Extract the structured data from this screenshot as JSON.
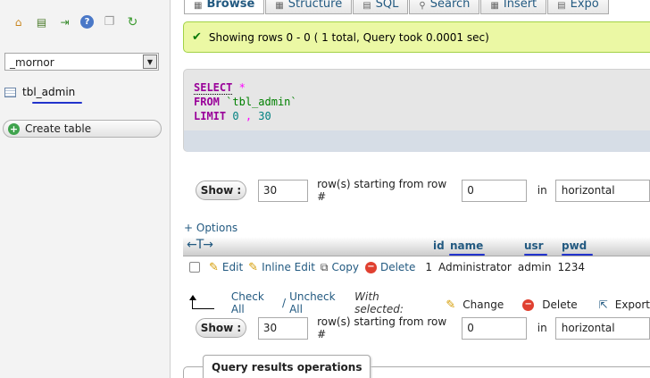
{
  "nav_panel": {
    "icons": [
      "home-icon",
      "database-icon",
      "logout-icon",
      "help-icon",
      "docs-icon",
      "reload-icon"
    ],
    "database_select": {
      "value": "_mornor"
    },
    "table_item": {
      "label": "tbl_admin"
    },
    "create_table_label": "Create table"
  },
  "tabs": [
    {
      "label": "Browse",
      "icon": "browse-icon"
    },
    {
      "label": "Structure",
      "icon": "structure-icon"
    },
    {
      "label": "SQL",
      "icon": "sql-icon"
    },
    {
      "label": "Search",
      "icon": "search-icon"
    },
    {
      "label": "Insert",
      "icon": "insert-icon"
    },
    {
      "label": "Expo",
      "icon": "export-icon"
    }
  ],
  "success_message": "Showing rows 0 - 0 ( 1 total, Query took 0.0001 sec)",
  "sql": {
    "select_kw": "SELECT",
    "star": "*",
    "from_kw": "FROM",
    "table": "`tbl_admin`",
    "limit_kw": "LIMIT",
    "limit_offset": "0",
    "comma": ",",
    "limit_count": "30"
  },
  "nav_top": {
    "show_label": "Show :",
    "rows": "30",
    "rows_text": "row(s) starting from row #",
    "start": "0",
    "in_text": "in",
    "mode": "horizontal"
  },
  "options_label": "+ Options",
  "columns": [
    "id",
    "name",
    "usr",
    "pwd"
  ],
  "row": {
    "edit": "Edit",
    "inline_edit": "Inline Edit",
    "copy": "Copy",
    "delete": "Delete",
    "id": "1",
    "name": "Administrator",
    "usr": "admin",
    "pwd": "1234"
  },
  "bulk": {
    "check_all": "Check All",
    "separator": "/",
    "uncheck_all": "Uncheck All",
    "with_selected": "With selected:",
    "change": "Change",
    "delete": "Delete",
    "export": "Export"
  },
  "nav_bottom": {
    "show_label": "Show :",
    "rows": "30",
    "rows_text": "row(s) starting from row #",
    "start": "0",
    "in_text": "in",
    "mode": "horizontal"
  },
  "query_results_operations": "Query results operations",
  "colors": {
    "link": "#235a81",
    "success_bg": "#ebf8a4",
    "annotation": "#2233cc"
  }
}
